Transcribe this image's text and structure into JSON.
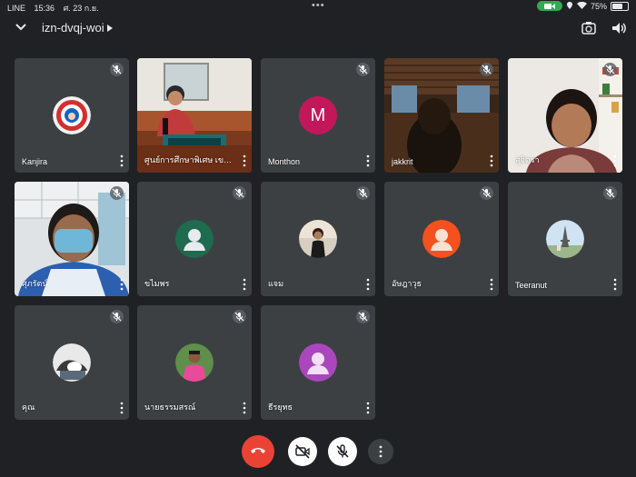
{
  "status_bar": {
    "app": "LINE",
    "time": "15:36",
    "date": "ศ. 23 ก.ย.",
    "battery": "75%",
    "battery_level": 0.75
  },
  "meeting": {
    "code": "izn-dvqj-woi"
  },
  "participants": [
    {
      "name": "Kanjira",
      "muted": true
    },
    {
      "name": "ศูนย์การศึกษาพิเศษ เขต...",
      "muted": false
    },
    {
      "name": "Monthon",
      "muted": true,
      "initial": "M"
    },
    {
      "name": "jakkrit",
      "muted": true
    },
    {
      "name": "สุจิตรา",
      "muted": true
    },
    {
      "name": "ศุภรัตน์",
      "muted": true
    },
    {
      "name": "ขไมพร",
      "muted": true
    },
    {
      "name": "แจม",
      "muted": true
    },
    {
      "name": "อัษฎาวุธ",
      "muted": true
    },
    {
      "name": "Teeranut",
      "muted": true
    },
    {
      "name": "คุณ",
      "muted": true
    },
    {
      "name": "นายธรรมสรณ์",
      "muted": true
    },
    {
      "name": "ธีรยุทธ",
      "muted": true
    }
  ],
  "colors": {
    "background": "#202124",
    "tile": "#3c4043",
    "hangup": "#ea4335",
    "monthon_avatar": "#c2185b",
    "kanjira_avatar": "#d32f2f",
    "khamaiporn_avatar": "#1e6b4f",
    "atsadawut_avatar": "#f4511e",
    "teerayut_avatar": "#ab47bc",
    "camera_pill": "#34a853"
  },
  "icons": {
    "back": "chevron-down-icon",
    "camera_switch": "camera-switch-icon",
    "speaker": "speaker-icon",
    "mic_off": "mic-off-icon",
    "more": "more-vert-icon",
    "hangup": "phone-hangup-icon",
    "camera_off": "videocam-off-icon"
  }
}
